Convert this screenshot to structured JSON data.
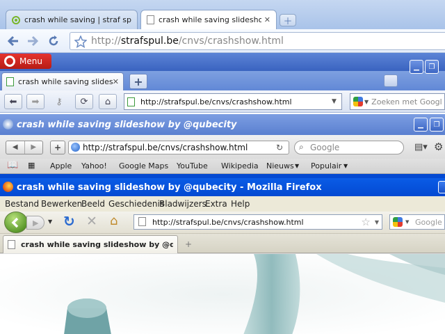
{
  "chrome": {
    "tabs": [
      {
        "label": "crash while saving | straf spul"
      },
      {
        "label": "crash while saving slidesho..."
      }
    ],
    "url_prefix": "http://",
    "url_host": "strafspul.be",
    "url_path": "/cnvs/crashshow.html"
  },
  "opera": {
    "menu_label": "Menu",
    "tab_label": "crash while saving slides...",
    "address": "http://strafspul.be/cnvs/crashshow.html",
    "search_placeholder": "Zoeken met Googl"
  },
  "safari": {
    "window_title": "crash while saving slideshow by @qubecity",
    "address": "http://strafspul.be/cnvs/crashshow.html",
    "search_placeholder": "Google",
    "bookmarks": [
      "Apple",
      "Yahoo!",
      "Google Maps",
      "YouTube",
      "Wikipedia",
      "Nieuws",
      "Populair"
    ]
  },
  "firefox": {
    "window_title": "crash while saving slideshow by @qubecity - Mozilla Firefox",
    "menus": [
      "Bestand",
      "Bewerken",
      "Beeld",
      "Geschiedenis",
      "Bladwijzers",
      "Extra",
      "Help"
    ],
    "address": "http://strafspul.be/cnvs/crashshow.html",
    "search_placeholder": "Google",
    "tab_label": "crash while saving slideshow by @qu..."
  },
  "colors": {
    "chrome_frame": "#a9c3e9",
    "opera_red": "#d22a23",
    "xp_blue": "#0349d2",
    "teal_shape": "#6fa3a6"
  }
}
